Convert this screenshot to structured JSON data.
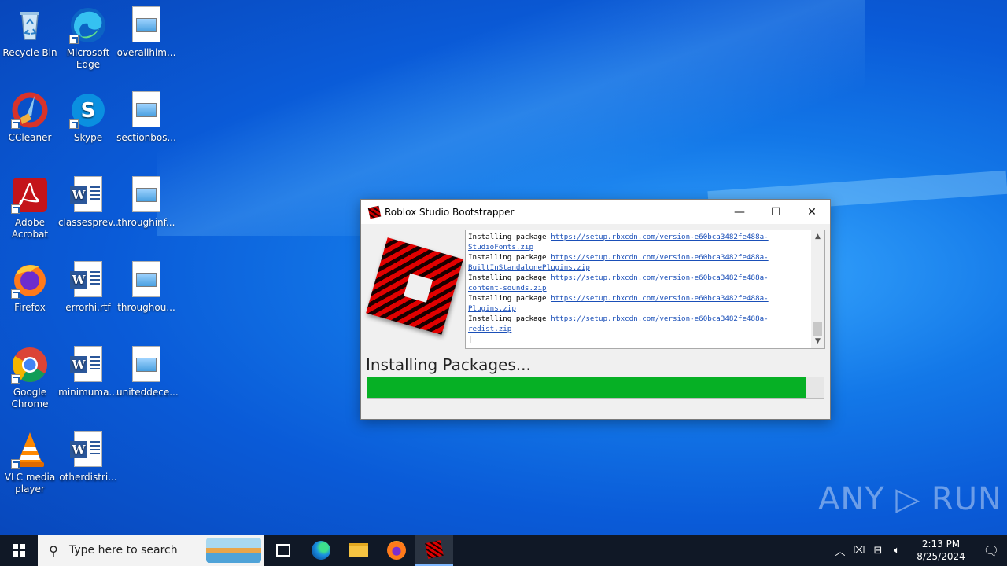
{
  "desktop": {
    "icons": [
      {
        "label": "Recycle Bin"
      },
      {
        "label": "Microsoft Edge"
      },
      {
        "label": "overallhim..."
      },
      {
        "label": "CCleaner"
      },
      {
        "label": "Skype"
      },
      {
        "label": "sectionbos..."
      },
      {
        "label": "Adobe Acrobat"
      },
      {
        "label": "classesprev..."
      },
      {
        "label": "throughinf..."
      },
      {
        "label": "Firefox"
      },
      {
        "label": "errorhi.rtf"
      },
      {
        "label": "throughou..."
      },
      {
        "label": "Google Chrome"
      },
      {
        "label": "minimuma..."
      },
      {
        "label": "uniteddece..."
      },
      {
        "label": "VLC media player"
      },
      {
        "label": "otherdistri..."
      }
    ]
  },
  "window": {
    "title": "Roblox Studio Bootstrapper",
    "controls": {
      "minimize": "—",
      "maximize": "☐",
      "close": "✕"
    },
    "log": [
      {
        "prefix": "Installing package ",
        "url": "https://setup.rbxcdn.com/version-e60bca3482fe488a-",
        "rest": "StudioFonts.zip"
      },
      {
        "prefix": "Installing package ",
        "url": "https://setup.rbxcdn.com/version-e60bca3482fe488a-",
        "rest": "BuiltInStandalonePlugins.zip"
      },
      {
        "prefix": "Installing package ",
        "url": "https://setup.rbxcdn.com/version-e60bca3482fe488a-",
        "rest": "content-sounds.zip"
      },
      {
        "prefix": "Installing package ",
        "url": "https://setup.rbxcdn.com/version-e60bca3482fe488a-",
        "rest": "Plugins.zip"
      },
      {
        "prefix": "Installing package ",
        "url": "https://setup.rbxcdn.com/version-e60bca3482fe488a-",
        "rest": "redist.zip"
      }
    ],
    "status": "Installing Packages...",
    "progress_fraction": 0.96
  },
  "watermark": "ANY ▷ RUN",
  "taskbar": {
    "search_placeholder": "Type here to search",
    "time": "2:13 PM",
    "date": "8/25/2024"
  },
  "colors": {
    "progress": "#06b025",
    "accent": "#0a5bd8"
  }
}
